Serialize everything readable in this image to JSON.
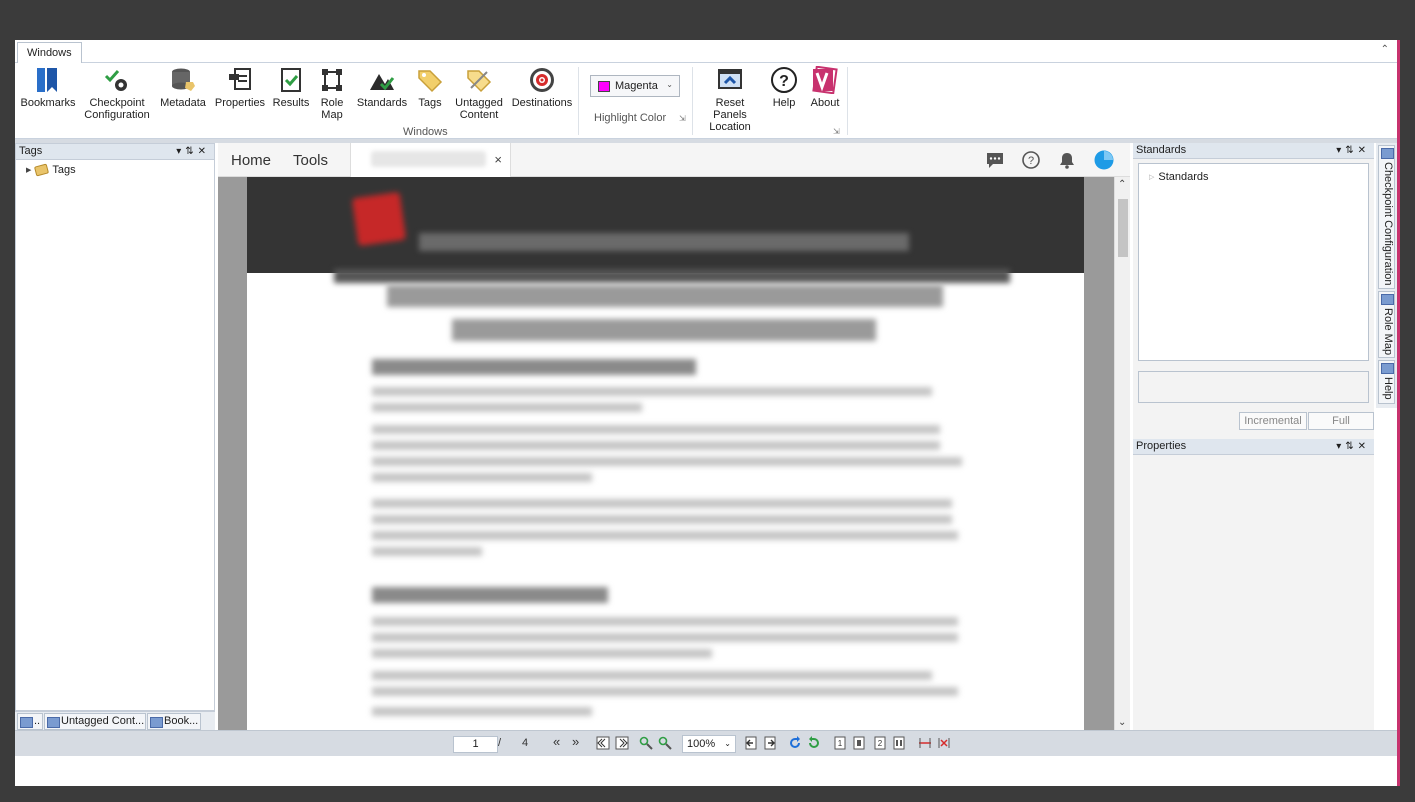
{
  "ribbon": {
    "tab_label": "Windows",
    "group_label": "Windows",
    "buttons": {
      "bookmarks": "Bookmarks",
      "checkpoint_line1": "Checkpoint",
      "checkpoint_line2": "Configuration",
      "metadata": "Metadata",
      "properties": "Properties",
      "results": "Results",
      "rolemap_line1": "Role",
      "rolemap_line2": "Map",
      "standards": "Standards",
      "tags": "Tags",
      "untagged_line1": "Untagged",
      "untagged_line2": "Content",
      "destinations": "Destinations",
      "reset_line1": "Reset Panels",
      "reset_line2": "Location",
      "help": "Help",
      "about": "About"
    },
    "highlight_color": {
      "value": "Magenta",
      "label": "Highlight Color",
      "swatch_color": "#ff00ff"
    }
  },
  "left_panel": {
    "title": "Tags",
    "tree_root": "Tags",
    "bottom_tabs": [
      "..",
      "Untagged Cont...",
      "Book..."
    ]
  },
  "viewer": {
    "nav_home": "Home",
    "nav_tools": "Tools",
    "doc_tab_close": "×"
  },
  "right_panel": {
    "standards_title": "Standards",
    "standards_root": "Standards",
    "incremental_label": "Incremental",
    "full_label": "Full",
    "properties_title": "Properties",
    "side_tabs": [
      "Checkpoint Configuration",
      "Role Map",
      "Help"
    ]
  },
  "statusbar": {
    "current_page": "1",
    "separator": "/",
    "total_pages": "4",
    "zoom": "100%"
  },
  "colors": {
    "accent_border": "#c8326e",
    "panel_header": "#dfe6ee",
    "toggle_blue": "#1e9be6"
  }
}
